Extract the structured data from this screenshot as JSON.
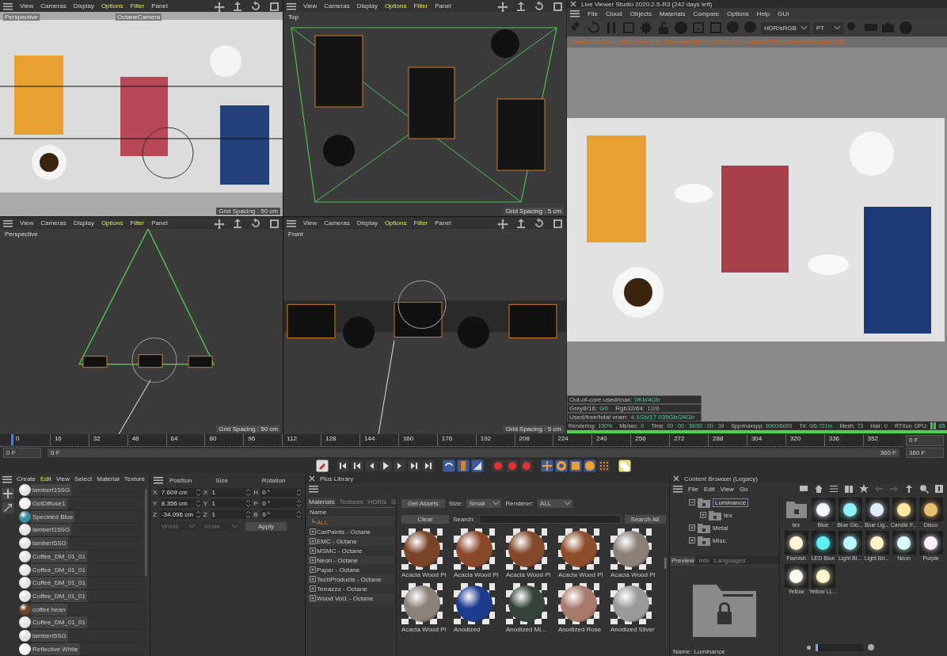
{
  "viewports": [
    {
      "menu": [
        {
          "label": "View",
          "highlighted": false
        },
        {
          "label": "Cameras",
          "highlighted": false
        },
        {
          "label": "Display",
          "highlighted": false
        },
        {
          "label": "Options",
          "highlighted": true
        },
        {
          "label": "Filter",
          "highlighted": true
        },
        {
          "label": "Panel",
          "highlighted": false
        }
      ],
      "camera": "Perspective",
      "camera_tag": "OctaneCamera",
      "grid_spacing": "Grid Spacing : 50 cm",
      "kind": "shaded"
    },
    {
      "menu": [
        {
          "label": "View",
          "highlighted": false
        },
        {
          "label": "Cameras",
          "highlighted": false
        },
        {
          "label": "Display",
          "highlighted": false
        },
        {
          "label": "Options",
          "highlighted": true
        },
        {
          "label": "Filter",
          "highlighted": true
        },
        {
          "label": "Panel",
          "highlighted": false
        }
      ],
      "camera": "Top",
      "grid_spacing": "Grid Spacing : 5 cm",
      "kind": "top"
    },
    {
      "menu": [
        {
          "label": "View",
          "highlighted": false
        },
        {
          "label": "Cameras",
          "highlighted": false
        },
        {
          "label": "Display",
          "highlighted": false
        },
        {
          "label": "Options",
          "highlighted": true
        },
        {
          "label": "Filter",
          "highlighted": true
        },
        {
          "label": "Panel",
          "highlighted": false
        }
      ],
      "camera": "Perspective",
      "grid_spacing": "Grid Spacing : 50 cm",
      "kind": "side"
    },
    {
      "menu": [
        {
          "label": "View",
          "highlighted": false
        },
        {
          "label": "Cameras",
          "highlighted": false
        },
        {
          "label": "Display",
          "highlighted": false
        },
        {
          "label": "Options",
          "highlighted": true
        },
        {
          "label": "Filter",
          "highlighted": true
        },
        {
          "label": "Panel",
          "highlighted": false
        }
      ],
      "camera": "Front",
      "grid_spacing": "Grid Spacing : 5 cm",
      "kind": "front"
    }
  ],
  "live_viewer": {
    "title": "Live Viewer Studio 2020.2.5-R3 (242 days left)",
    "menu": [
      "File",
      "Cloud",
      "Objects",
      "Materials",
      "Compare",
      "Options",
      "Help",
      "GUI"
    ],
    "color_space": "HDR/sRGB",
    "kernel": "PT",
    "log": "Check:0ms./0ms. MeshGen:4ms. Update[CG]:0ms. Mesh:13 Nodes:209 Movable:69 txCached:25",
    "stats": [
      [
        {
          "label": "Out-of-core used/max:",
          "value": "0Kb/4Gb"
        }
      ],
      [
        {
          "label": "Grey8/16:",
          "value": "0/0"
        },
        {
          "label": "Rgb32/64:",
          "value": "12/8"
        }
      ],
      [
        {
          "label": "Used/free/total vram:",
          "value": "4.1Gb/17.039Gb/24Gb"
        }
      ]
    ],
    "status": [
      {
        "label": "Rendering:",
        "value": "100%"
      },
      {
        "label": "Ms/sec:",
        "value": "0"
      },
      {
        "label": "Time:",
        "value": "00 : 00 : 39/00 : 00 : 39"
      },
      {
        "label": "Spp/maxspp:",
        "value": "6000/6000"
      },
      {
        "label": "Tri:",
        "value": "0/6.721m"
      },
      {
        "label": "Mesh:",
        "value": "72"
      },
      {
        "label": "Hair:",
        "value": "0"
      },
      {
        "label": "RTXon"
      },
      {
        "label": "GPU:",
        "value": "65",
        "kind": "gpu"
      }
    ],
    "progress": {
      "level": 1
    }
  },
  "timeline": {
    "ticks": [
      "0",
      "16",
      "32",
      "48",
      "64",
      "80",
      "96",
      "112",
      "128",
      "144",
      "160",
      "176",
      "192",
      "208",
      "224",
      "240",
      "256",
      "272",
      "288",
      "304",
      "320",
      "336",
      "352"
    ],
    "current": "0 F",
    "start": "0 F",
    "range_start": "0 F",
    "range_end": "360 F",
    "end": "360 F",
    "range": {
      "level": 1
    }
  },
  "material_manager": {
    "menu": [
      {
        "label": "Create",
        "highlighted": false
      },
      {
        "label": "Edit",
        "highlighted": true
      },
      {
        "label": "View",
        "highlighted": false
      },
      {
        "label": "Select",
        "highlighted": false
      },
      {
        "label": "Material",
        "highlighted": false
      },
      {
        "label": "Texture",
        "highlighted": false
      }
    ],
    "items": [
      {
        "name": "lambert15SG",
        "color": "#e6e6e6"
      },
      {
        "name": "OctDiffuse1",
        "color": "#f0f0f0"
      },
      {
        "name": "Speckled Blue",
        "color": "#3a8fa0"
      },
      {
        "name": "lambert15SG",
        "color": "#e6e6e6"
      },
      {
        "name": "lambert5SG",
        "color": "#e6e6e6"
      },
      {
        "name": "Coffee_DM_01_01",
        "color": "#e6e6e6"
      },
      {
        "name": "Coffee_DM_01_01",
        "color": "#e6e6e6"
      },
      {
        "name": "Coffee_DM_01_01",
        "color": "#e6e6e6"
      },
      {
        "name": "Coffee_DM_01_01",
        "color": "#e6e6e6"
      },
      {
        "name": "coffee bean",
        "color": "#6a4424"
      },
      {
        "name": "Coffee_DM_01_01",
        "color": "#e6e6e6"
      },
      {
        "name": "lambert5SG",
        "color": "#e6e6e6"
      },
      {
        "name": "Reflective White",
        "color": "#f4f4f4"
      }
    ]
  },
  "coordinates": {
    "headers": [
      "Position",
      "Size",
      "Rotation"
    ],
    "rows": [
      [
        {
          "axis": "X",
          "value": "7.609 cm"
        },
        {
          "axis": "X",
          "value": "1"
        },
        {
          "axis": "H",
          "value": "0 °"
        }
      ],
      [
        {
          "axis": "Y",
          "value": "8.356 cm"
        },
        {
          "axis": "Y",
          "value": "1"
        },
        {
          "axis": "P",
          "value": "0 °"
        }
      ],
      [
        {
          "axis": "Z",
          "value": "-34.096 cm"
        },
        {
          "axis": "Z",
          "value": "1"
        },
        {
          "axis": "B",
          "value": "0 °"
        }
      ]
    ],
    "dropdowns": [
      {
        "value": "World",
        "disabled": true
      },
      {
        "value": "Scale",
        "disabled": true
      }
    ],
    "apply": "Apply"
  },
  "plus_library": {
    "title": "Plus Library",
    "tabs": [
      {
        "label": "Materials",
        "selected": true
      },
      {
        "label": "Textures",
        "selected": false
      },
      {
        "label": "HDRIs",
        "selected": false
      },
      {
        "label": "G",
        "selected": false
      }
    ],
    "tree_header": "Name",
    "tree": [
      {
        "label": "ALL",
        "selected": true,
        "expandable": false
      },
      {
        "label": "CarPaints - Octane",
        "selected": false,
        "expandable": true
      },
      {
        "label": "EMC - Octane",
        "selected": false,
        "expandable": true
      },
      {
        "label": "MSMC - Octane",
        "selected": false,
        "expandable": true
      },
      {
        "label": "Neon - Octane",
        "selected": false,
        "expandable": true
      },
      {
        "label": "Paper - Octane",
        "selected": false,
        "expandable": true
      },
      {
        "label": "TechProducts - Octane",
        "selected": false,
        "expandable": true
      },
      {
        "label": "Terrazzo - Octane",
        "selected": false,
        "expandable": true
      },
      {
        "label": "Wood Vol1 - Octane",
        "selected": false,
        "expandable": true
      }
    ],
    "get_assets": "Get Assets",
    "size_label": "Size:",
    "size": "Small",
    "renderer_label": "Renderer:",
    "renderer": "ALL",
    "clear": "Clear",
    "search_label": "Search:",
    "search_all": "Search All",
    "assets": [
      {
        "name": "Acacia Wood Pl",
        "color": "#7a4428"
      },
      {
        "name": "Acacia Wood Pl",
        "color": "#8a4a2a"
      },
      {
        "name": "Acacia Wood Pl",
        "color": "#84482a"
      },
      {
        "name": "Acacia Wood Pl",
        "color": "#8e4e2c"
      },
      {
        "name": "Acacia Wood Pl",
        "color": "#8a8078"
      },
      {
        "name": "Acacia Wood Pl",
        "color": "#8c8078"
      },
      {
        "name": "Anodized",
        "color": "#1c3c90"
      },
      {
        "name": "Anodized Ml...",
        "color": "#34443a"
      },
      {
        "name": "Anodized Rose",
        "color": "#a87a6c"
      },
      {
        "name": "Anodized Silver",
        "color": "#9a9a9a"
      }
    ]
  },
  "content_browser": {
    "title": "Content Browser (Legacy)",
    "menu": [
      "File",
      "Edit",
      "View",
      "Go"
    ],
    "tree": [
      {
        "label": "Luminance",
        "selected": true,
        "children": [
          {
            "label": "tex",
            "selected": false
          }
        ]
      },
      {
        "label": "Metal",
        "selected": false
      },
      {
        "label": "Misc.",
        "selected": false
      }
    ],
    "tabs": [
      {
        "label": "Preview",
        "selected": true
      },
      {
        "label": "Info",
        "selected": false
      },
      {
        "label": "Languages",
        "selected": false
      }
    ],
    "name_label": "Name:",
    "name": "Luminance",
    "zoom": {
      "level": 0.05
    },
    "items": [
      {
        "name": "tex",
        "kind": "folder"
      },
      {
        "name": "Blue",
        "kind": "light",
        "color": "#f4f8ff"
      },
      {
        "name": "Blue Glo...",
        "kind": "light",
        "color": "#8ff0f8"
      },
      {
        "name": "Blue Lig...",
        "kind": "light",
        "color": "#e0ecff"
      },
      {
        "name": "Candle F...",
        "kind": "light",
        "color": "#ffe8a0"
      },
      {
        "name": "Disco",
        "kind": "light",
        "color": "#e8c070"
      },
      {
        "name": "Flamish",
        "kind": "light",
        "color": "#fff4d8"
      },
      {
        "name": "LED Blue",
        "kind": "light",
        "color": "#60f0f8"
      },
      {
        "name": "Light Bl...",
        "kind": "light",
        "color": "#b8f8fc"
      },
      {
        "name": "Light Bri...",
        "kind": "light",
        "color": "#fff0c8"
      },
      {
        "name": "Neon",
        "kind": "light",
        "color": "#d8fcff"
      },
      {
        "name": "Purple",
        "kind": "light",
        "color": "#fff0ff"
      },
      {
        "name": "Yellow",
        "kind": "light",
        "color": "#fffaf0"
      },
      {
        "name": "Yellow LL...",
        "kind": "light",
        "color": "#fff4d0"
      }
    ]
  }
}
